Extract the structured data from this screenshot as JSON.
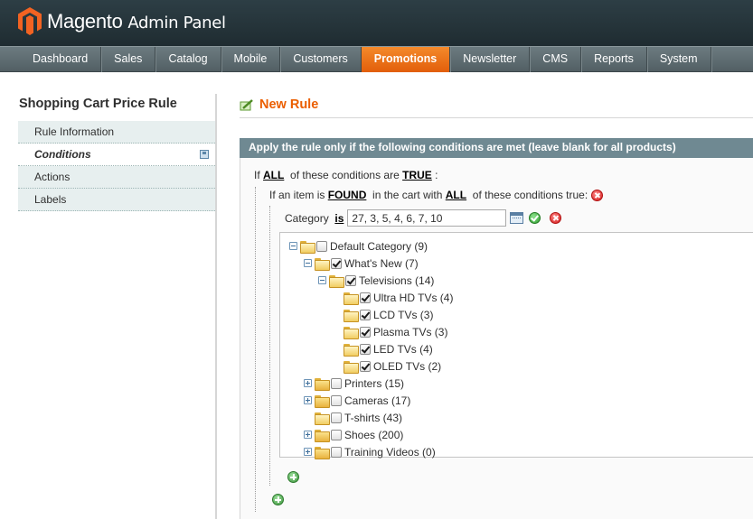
{
  "header": {
    "brand": "Magento",
    "subtitle": "Admin Panel"
  },
  "nav": {
    "items": [
      "Dashboard",
      "Sales",
      "Catalog",
      "Mobile",
      "Customers",
      "Promotions",
      "Newsletter",
      "CMS",
      "Reports",
      "System"
    ],
    "active": "Promotions"
  },
  "sidebar": {
    "title": "Shopping Cart Price Rule",
    "tabs": [
      "Rule Information",
      "Conditions",
      "Actions",
      "Labels"
    ],
    "active_tab": "Conditions"
  },
  "main": {
    "title": "New Rule",
    "section_title": "Apply the rule only if the following conditions are met (leave blank for all products)",
    "line1": {
      "prefix": "If",
      "aggregator": "ALL",
      "middle": "of these conditions are",
      "value": "TRUE",
      "suffix": ":"
    },
    "line2": {
      "prefix": "If an item is",
      "found": "FOUND",
      "middle": "in the cart with",
      "aggregator": "ALL",
      "suffix": "of these conditions true:"
    },
    "condition": {
      "attribute": "Category",
      "operator": "is",
      "value": "27, 3, 5, 4, 6, 7, 10"
    }
  },
  "tree": [
    {
      "label": "Default Category (9)",
      "checked": false,
      "toggle": "open",
      "folder": "open"
    },
    {
      "label": "What's New (7)",
      "checked": true,
      "toggle": "open",
      "folder": "open"
    },
    {
      "label": "Televisions (14)",
      "checked": true,
      "toggle": "open",
      "folder": "open"
    },
    {
      "label": "Ultra HD TVs (4)",
      "checked": true,
      "toggle": "none",
      "folder": "open"
    },
    {
      "label": "LCD TVs (3)",
      "checked": true,
      "toggle": "none",
      "folder": "open"
    },
    {
      "label": "Plasma TVs (3)",
      "checked": true,
      "toggle": "none",
      "folder": "open"
    },
    {
      "label": "LED TVs (4)",
      "checked": true,
      "toggle": "none",
      "folder": "open"
    },
    {
      "label": "OLED TVs (2)",
      "checked": true,
      "toggle": "none",
      "folder": "open"
    },
    {
      "label": "Printers (15)",
      "checked": false,
      "toggle": "closed",
      "folder": "closed"
    },
    {
      "label": "Cameras (17)",
      "checked": false,
      "toggle": "closed",
      "folder": "closed"
    },
    {
      "label": "T-shirts (43)",
      "checked": false,
      "toggle": "none",
      "folder": "open"
    },
    {
      "label": "Shoes (200)",
      "checked": false,
      "toggle": "closed",
      "folder": "closed"
    },
    {
      "label": "Training Videos (0)",
      "checked": false,
      "toggle": "closed",
      "folder": "closed"
    }
  ],
  "colors": {
    "accent": "#eb5e00",
    "nav_active": "#f48a2b",
    "section_head": "#6f8992"
  }
}
